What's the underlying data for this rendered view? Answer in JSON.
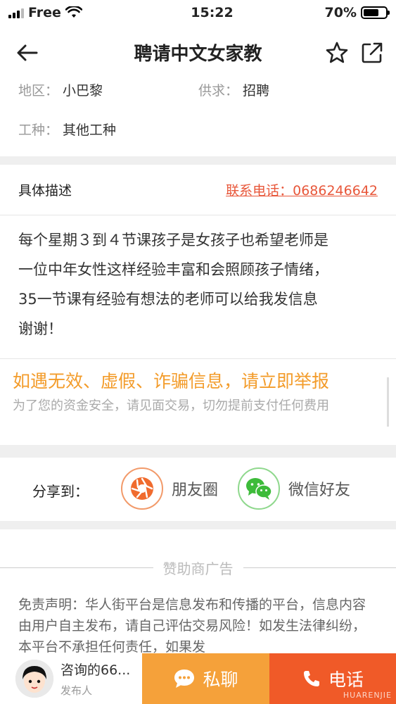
{
  "status_bar": {
    "carrier": "Free",
    "time": "15:22",
    "battery": "70%",
    "battery_level": 0.7
  },
  "nav": {
    "title": "聘请中文女家教"
  },
  "info": {
    "region_label": "地区：",
    "region_value": "小巴黎",
    "supply_label": "供求：",
    "supply_value": "招聘",
    "type_label": "工种：",
    "type_value": "其他工种"
  },
  "description": {
    "header": "具体描述",
    "contact": "联系电话：0686246642",
    "lines": [
      "每个星期３到４节课孩子是女孩子也希望老师是",
      "一位中年女性这样经验丰富和会照顾孩子情绪，",
      "35一节课有经验有想法的老师可以给我发信息",
      "谢谢！"
    ]
  },
  "warning": {
    "title": "如遇无效、虚假、诈骗信息，请立即举报",
    "subtitle": "为了您的资金安全，请见面交易，切勿提前支付任何费用"
  },
  "share": {
    "label": "分享到：",
    "moments": "朋友圈",
    "wechat": "微信好友"
  },
  "sponsor": {
    "label": "赞助商广告"
  },
  "disclaimer": {
    "text": "免责声明：华人街平台是信息发布和传播的平台，信息内容由用户自主发布，请自己评估交易风险！如发生法律纠纷，本平台不承担任何责任，如果发"
  },
  "bottom": {
    "user_name": "咨询的66...",
    "user_role": "发布人",
    "chat_label": "私聊",
    "call_label": "电话",
    "watermark": "HUARENJIE"
  },
  "colors": {
    "orange": "#f5a13a",
    "red_orange": "#f05a28",
    "contact_red": "#e8573a",
    "warn_orange": "#f39c2b",
    "wechat_green": "#3dbb3a"
  }
}
